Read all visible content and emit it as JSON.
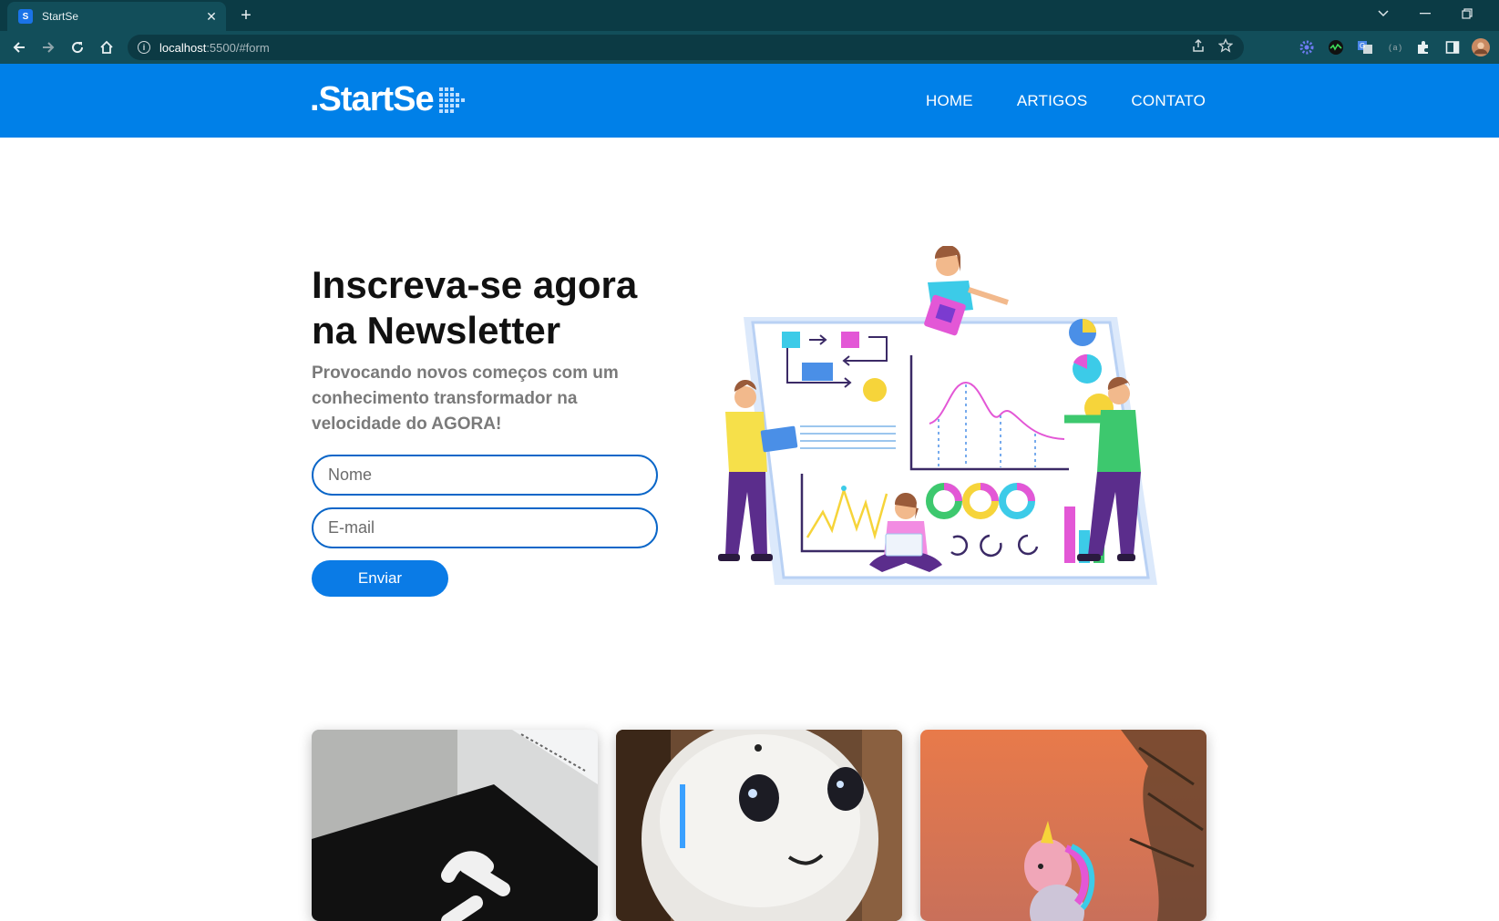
{
  "browser": {
    "tab_title": "StartSe",
    "tab_favicon": "S",
    "url_host": "localhost",
    "url_rest": ":5500/#form"
  },
  "header": {
    "logo_text": ".StartSe",
    "nav": [
      "HOME",
      "ARTIGOS",
      "CONTATO"
    ]
  },
  "hero": {
    "title_line1": "Inscreva-se agora",
    "title_line2": "na Newsletter",
    "subtitle": "Provocando novos começos com um conhecimento transformador na velocidade do AGORA!"
  },
  "form": {
    "name_placeholder": "Nome",
    "email_placeholder": "E-mail",
    "submit_label": "Enviar"
  },
  "colors": {
    "brand_blue": "#0080e8",
    "browser_dark": "#0b3b45",
    "field_border": "#0a66c8"
  },
  "cards": [
    {
      "image": "laptop-photo"
    },
    {
      "image": "robot-photo"
    },
    {
      "image": "unicorn-photo"
    }
  ]
}
